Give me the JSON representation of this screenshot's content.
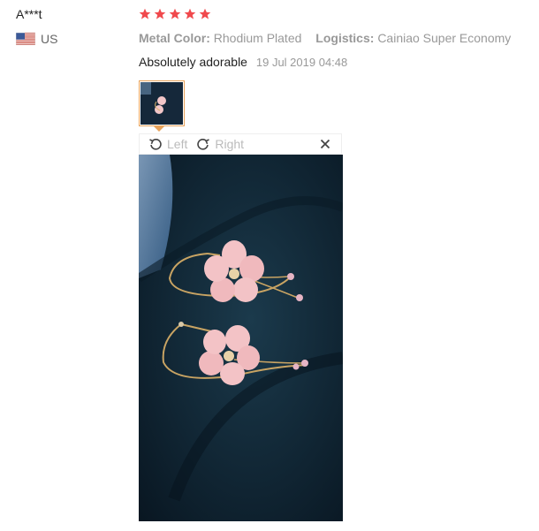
{
  "review": {
    "reviewer": "A***t",
    "country": "US",
    "rating": 5,
    "attributes": [
      {
        "label": "Metal Color:",
        "value": "Rhodium Plated"
      },
      {
        "label": "Logistics:",
        "value": "Cainiao Super Economy"
      }
    ],
    "comment": "Absolutely adorable",
    "date": "19 Jul 2019 04:48"
  },
  "viewer": {
    "rotate_left": "Left",
    "rotate_right": "Right"
  },
  "colors": {
    "star": "#f0494d",
    "thumb_border": "#e8a35b"
  }
}
